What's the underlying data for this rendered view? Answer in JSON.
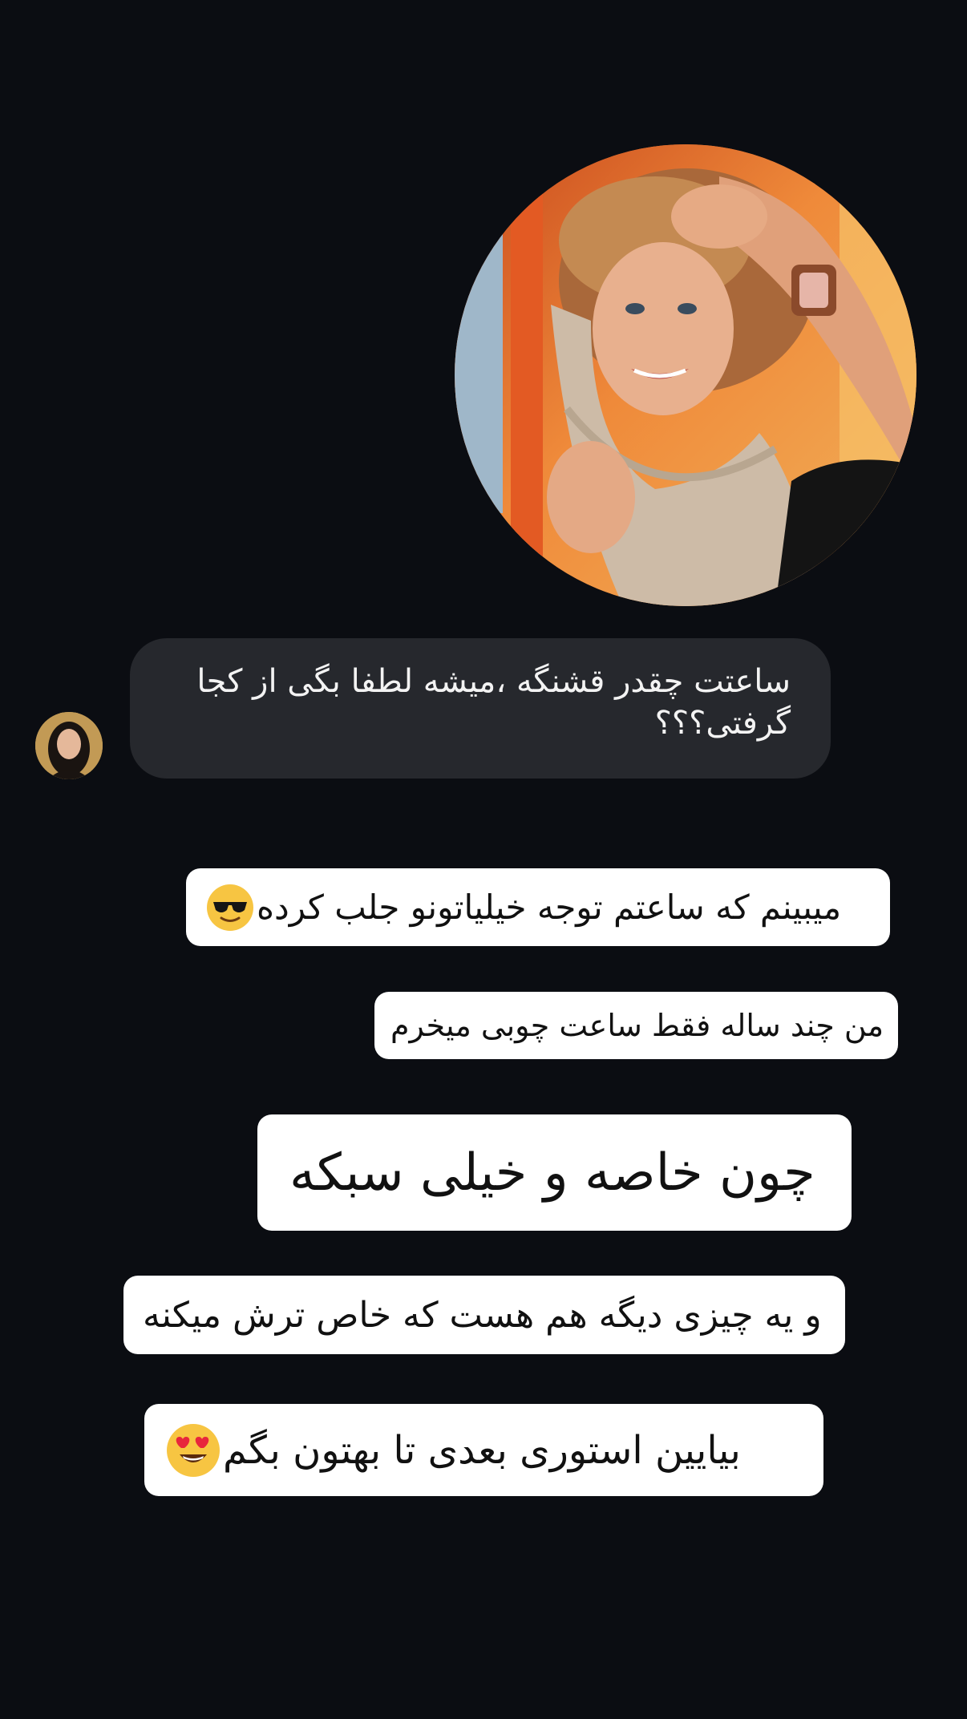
{
  "story": {
    "profile_photo": "woman-with-wooden-watch-photo",
    "dm": {
      "avatar": "sender-avatar",
      "message": "ساعتت چقدر قشنگه ،میشه لطفا بگی از کجا گرفتی؟؟؟"
    },
    "captions": [
      {
        "text": "میبینم که ساعتم توجه خیلیاتونو جلب کرده",
        "emoji": "smiling-face-with-sunglasses-emoji"
      },
      {
        "text": "من چند ساله فقط ساعت چوبی میخرم",
        "emoji": ""
      },
      {
        "text": "چون خاصه و خیلی سبکه",
        "emoji": ""
      },
      {
        "text": "و یه چیزی دیگه هم هست که خاص ترش میکنه",
        "emoji": ""
      },
      {
        "text": "بیایین استوری بعدی تا بهتون بگم",
        "emoji": "smiling-face-with-heart-eyes-emoji"
      }
    ]
  },
  "colors": {
    "background": "#0b0d12",
    "dm_bubble": "#26282d",
    "caption_bg": "#ffffff",
    "caption_text": "#111111"
  }
}
